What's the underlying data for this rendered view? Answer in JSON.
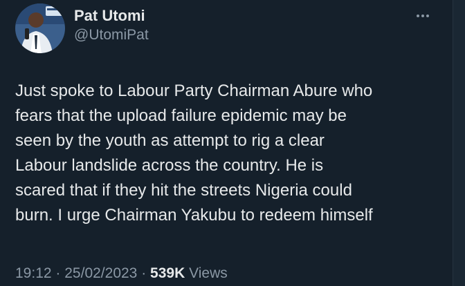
{
  "author": {
    "display_name": "Pat Utomi",
    "handle": "@UtomiPat"
  },
  "tweet": {
    "text": "Just spoke to Labour Party Chairman Abure who\nfears that the upload failure epidemic may be\nseen by the youth as attempt to rig a clear\nLabour landslide across the country. He is\nscared that if they hit the streets Nigeria could\nburn. I urge Chairman Yakubu to redeem himself"
  },
  "meta": {
    "time": "19:12",
    "separator": "·",
    "date": "25/02/2023",
    "views_count": "539K",
    "views_label": "Views"
  },
  "icons": {
    "more": "more-horizontal-icon",
    "avatar": "avatar-photo"
  },
  "colors": {
    "background": "#15202b",
    "text_primary": "#e7e9ea",
    "text_secondary": "#8b98a5"
  }
}
